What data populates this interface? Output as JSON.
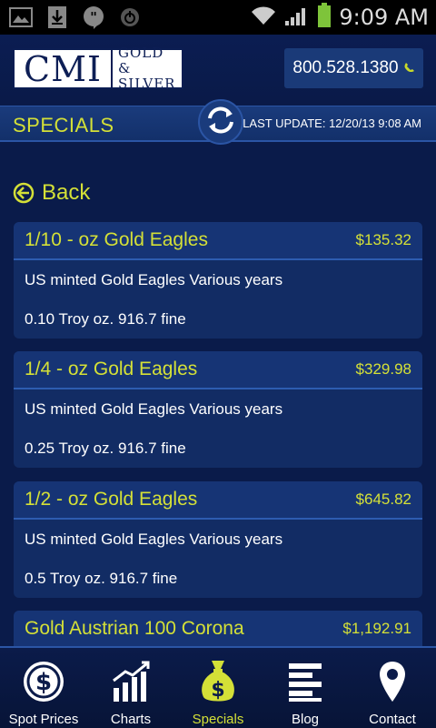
{
  "status": {
    "time": "9:09 AM"
  },
  "header": {
    "logo_main": "CMI",
    "logo_line1": "GOLD &",
    "logo_line2": "SILVER",
    "phone": "800.528.1380"
  },
  "title_bar": {
    "title": "SPECIALS",
    "last_update": "LAST UPDATE: 12/20/13 9:08 AM"
  },
  "back_label": "Back",
  "products": [
    {
      "title": "1/10 - oz Gold Eagles",
      "price": "$135.32",
      "desc": "US minted Gold Eagles Various years",
      "spec": "0.10 Troy oz. 916.7 fine"
    },
    {
      "title": "1/4 - oz Gold Eagles",
      "price": "$329.98",
      "desc": "US minted Gold Eagles Various years",
      "spec": "0.25 Troy oz. 916.7 fine"
    },
    {
      "title": "1/2 - oz Gold Eagles",
      "price": "$645.82",
      "desc": "US minted Gold Eagles Various years",
      "spec": "0.5 Troy oz. 916.7 fine"
    },
    {
      "title": "Gold Austrian 100 Corona",
      "price": "$1,192.91"
    }
  ],
  "nav": [
    {
      "label": "Spot Prices",
      "icon": "dollar-icon",
      "active": false
    },
    {
      "label": "Charts",
      "icon": "chart-icon",
      "active": false
    },
    {
      "label": "Specials",
      "icon": "money-bag-icon",
      "active": true
    },
    {
      "label": "Blog",
      "icon": "blog-icon",
      "active": false
    },
    {
      "label": "Contact",
      "icon": "location-pin-icon",
      "active": false
    }
  ],
  "colors": {
    "accent": "#d4e037",
    "background": "#0a1b4a",
    "card": "#122c64"
  }
}
